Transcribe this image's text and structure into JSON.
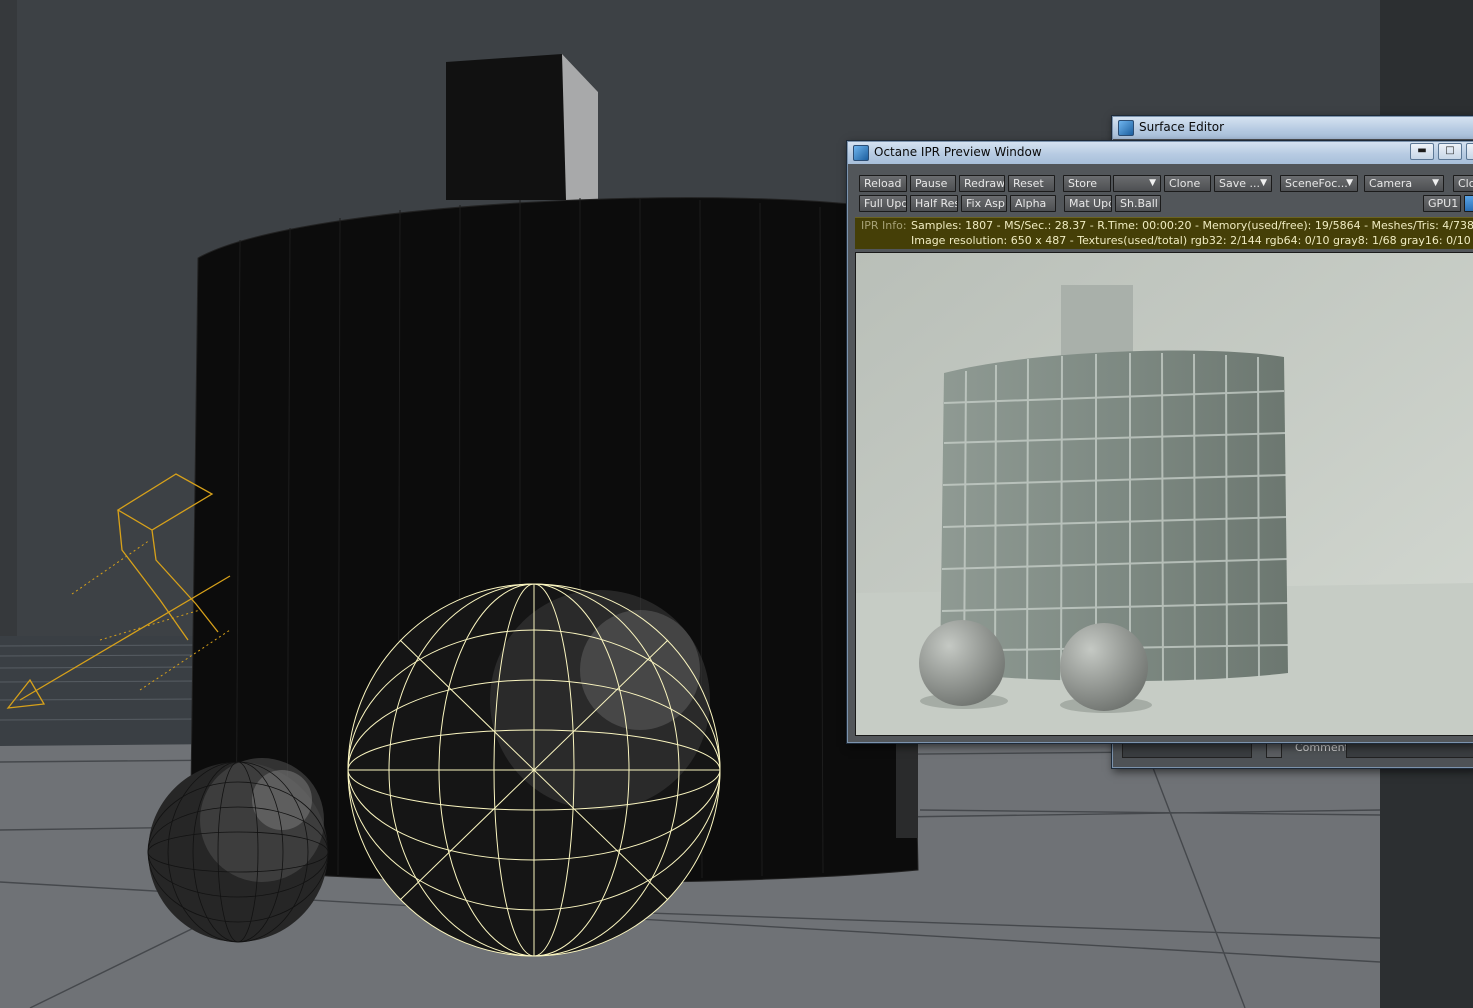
{
  "ipr_window": {
    "title": "Octane IPR Preview Window",
    "row1": {
      "reload": "Reload",
      "pause": "Pause",
      "redraw": "Redraw",
      "reset": "Reset",
      "store": "Store",
      "store_slot": "",
      "clone": "Clone",
      "save": "Save ...",
      "scene_focus": "SceneFoc...",
      "camera": "Camera",
      "close": "Clo"
    },
    "row2": {
      "full_update": "Full Upd.",
      "half_res": "Half Res",
      "fix_aspect": "Fix Asp.",
      "alpha": "Alpha",
      "mat_update": "Mat Upd",
      "shadow_ball": "Sh.Ball",
      "gpu": "GPU1"
    },
    "info": {
      "label": "IPR Info:",
      "line1": "Samples: 1807  -  MS/Sec.: 28.37  -  R.Time: 00:00:20 - Memory(used/free): 19/5864  -  Meshes/Tris: 4/738",
      "line2": "Image resolution: 650 x 487 - Textures(used/total) rgb32: 2/144   rgb64: 0/10   gray8: 1/68   gray16: 0/10"
    }
  },
  "surface_editor": {
    "title": "Surface Editor",
    "comment_label": "Comment"
  },
  "colors": {
    "selection_wire": "#fbf6c0",
    "light_wire": "#d7a11a",
    "info_bar": "#453f07",
    "button_face": "#5b5d60"
  }
}
